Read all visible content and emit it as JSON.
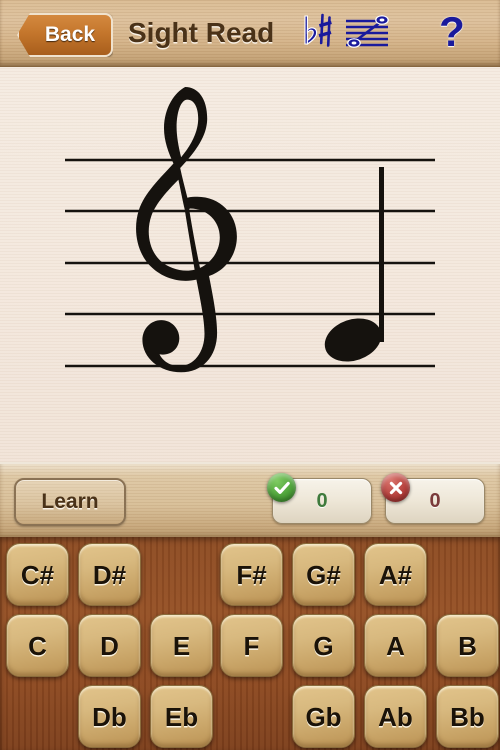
{
  "header": {
    "back_label": "Back",
    "title": "Sight Read",
    "help_label": "?",
    "icons": {
      "accidental": "flat-sharp-icon",
      "range": "staff-range-icon",
      "help": "question-mark-icon"
    }
  },
  "staff": {
    "clef": "treble",
    "line_count": 5,
    "note": {
      "name": "F",
      "pitch": "F4",
      "position": "space-1",
      "stem": "up",
      "head": "filled"
    }
  },
  "controls": {
    "learn_label": "Learn",
    "score_correct": "0",
    "score_wrong": "0",
    "correct_icon": "check-circle-icon",
    "wrong_icon": "x-circle-icon"
  },
  "keypad": {
    "rows": [
      {
        "name": "sharps",
        "keys": [
          {
            "label": "C#",
            "col": 0
          },
          {
            "label": "D#",
            "col": 1
          },
          {
            "label": "F#",
            "col": 3
          },
          {
            "label": "G#",
            "col": 4
          },
          {
            "label": "A#",
            "col": 5
          }
        ]
      },
      {
        "name": "naturals",
        "keys": [
          {
            "label": "C",
            "col": 0
          },
          {
            "label": "D",
            "col": 1
          },
          {
            "label": "E",
            "col": 2
          },
          {
            "label": "F",
            "col": 3
          },
          {
            "label": "G",
            "col": 4
          },
          {
            "label": "A",
            "col": 5
          },
          {
            "label": "B",
            "col": 6
          }
        ]
      },
      {
        "name": "flats",
        "keys": [
          {
            "label": "Db",
            "col": 1
          },
          {
            "label": "Eb",
            "col": 2
          },
          {
            "label": "Gb",
            "col": 4
          },
          {
            "label": "Ab",
            "col": 5
          },
          {
            "label": "Bb",
            "col": 6
          }
        ]
      }
    ]
  },
  "colors": {
    "header_wood": "#d3b288",
    "keypad_wood": "#8b4a22",
    "key_face": "#d8b97f",
    "staff_bg": "#f3e7dc",
    "back_button": "#c4762c",
    "accent_blue": "#1a1a9c",
    "correct_green": "#4ea33a",
    "wrong_red": "#b5403c",
    "title_brown": "#4a3218"
  }
}
